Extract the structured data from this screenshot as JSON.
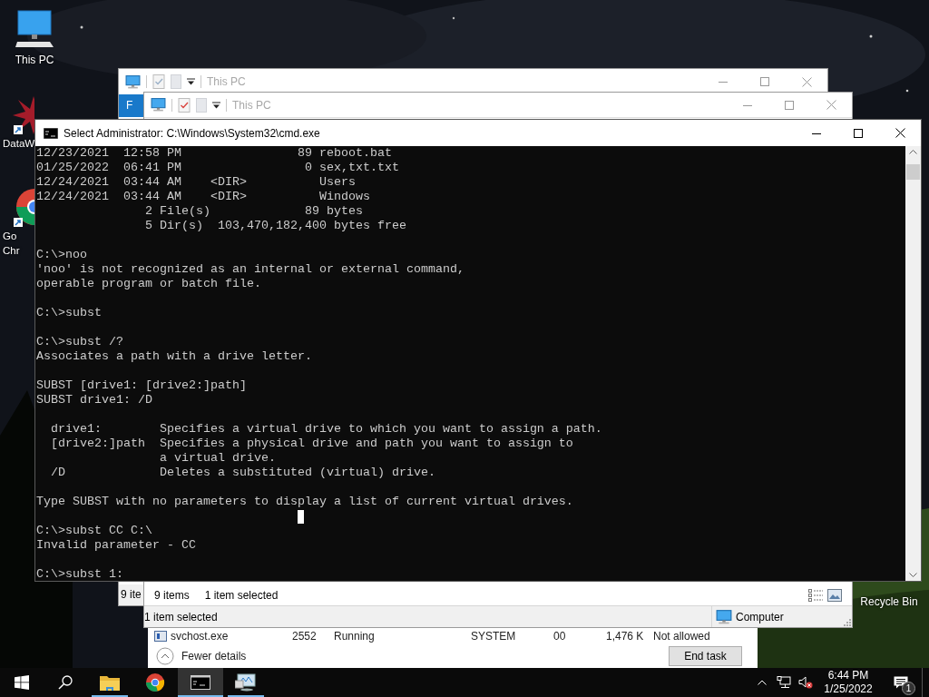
{
  "desktop_icons": [
    {
      "kind": "computer",
      "label_lines": [
        "This PC"
      ]
    },
    {
      "kind": "starburst",
      "label_lines": [
        "DataW"
      ]
    },
    {
      "kind": "browser",
      "label_lines": [
        "Go",
        "Chr"
      ]
    },
    {
      "kind": "recycle",
      "label_lines": [
        "Recycle Bin"
      ]
    }
  ],
  "explorer_back": {
    "title": "This PC",
    "ribbon_tab": "F",
    "status": "9 ite"
  },
  "explorer_front": {
    "title": "This PC",
    "item_count": "9 items",
    "selection": "1 item selected",
    "details_selection": "1 item selected",
    "location": "Computer"
  },
  "task_manager": {
    "row": [
      "svchost.exe",
      "2552",
      "Running",
      "SYSTEM",
      "00",
      "1,476 K",
      "Not allowed"
    ],
    "fewer_details": "Fewer details",
    "end_task": "End task"
  },
  "cmd": {
    "title": "Select Administrator: C:\\Windows\\System32\\cmd.exe",
    "blocks": [
      [
        "12/23/2021  12:58 PM                89 reboot.bat",
        "01/25/2022  06:41 PM                 0 sex,txt.txt",
        "12/24/2021  03:44 AM    <DIR>          Users",
        "12/24/2021  03:44 AM    <DIR>          Windows",
        "               2 File(s)             89 bytes",
        "               5 Dir(s)  103,470,182,400 bytes free"
      ],
      [
        "C:\\>noo",
        "'noo' is not recognized as an internal or external command,",
        "operable program or batch file."
      ],
      [
        "C:\\>subst"
      ],
      [
        "C:\\>subst /?",
        "Associates a path with a drive letter."
      ],
      [
        "SUBST [drive1: [drive2:]path]",
        "SUBST drive1: /D"
      ],
      [
        "  drive1:        Specifies a virtual drive to which you want to assign a path.",
        "  [drive2:]path  Specifies a physical drive and path you want to assign to",
        "                 a virtual drive.",
        "  /D             Deletes a substituted (virtual) drive."
      ],
      [
        "Type SUBST with no parameters to display a list of current virtual drives."
      ],
      [
        "C:\\>subst CC C:\\",
        "Invalid parameter - CC"
      ],
      [
        "C:\\>subst 1:"
      ]
    ]
  },
  "taskbar": {
    "apps": [
      {
        "kind": "folder",
        "running": true,
        "selected": false
      },
      {
        "kind": "browser",
        "running": false,
        "selected": false
      },
      {
        "kind": "console",
        "running": true,
        "selected": true
      },
      {
        "kind": "monitor",
        "running": true,
        "selected": false
      }
    ],
    "time": "6:44 PM",
    "date": "1/25/2022",
    "notification_count": "1"
  }
}
